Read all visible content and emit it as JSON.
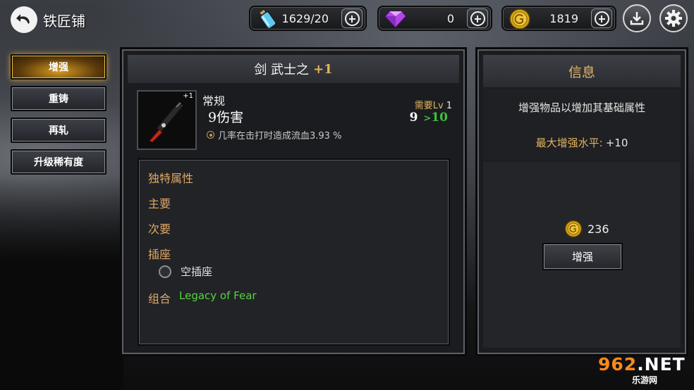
{
  "header": {
    "title": "铁匠铺",
    "back_icon": "back-arrow-icon"
  },
  "resources": {
    "potion": {
      "value": "1629/20",
      "icon": "potion-bottle-icon"
    },
    "gem": {
      "value": "0",
      "icon": "purple-gem-icon"
    },
    "gold": {
      "value": "1819",
      "icon": "gold-coin-icon"
    },
    "download_icon": "download-icon",
    "settings_icon": "gear-icon"
  },
  "menu": {
    "items": [
      {
        "label": "增强",
        "active": true
      },
      {
        "label": "重铸",
        "active": false
      },
      {
        "label": "再轧",
        "active": false
      },
      {
        "label": "升级稀有度",
        "active": false
      }
    ]
  },
  "item": {
    "name": "剑 武士之",
    "plus": "+1",
    "badge": "+1",
    "rarity": "常规",
    "damage": "9伤害",
    "effect": "几率在击打时造成流血3.93 %",
    "req_label": "需要Lv",
    "req_value": "1",
    "level_from": "9",
    "level_arrow": ">",
    "level_to": "10"
  },
  "properties": {
    "unique": "独特属性",
    "primary": "主要",
    "secondary": "次要",
    "socket": "插座",
    "empty_socket": "空插座",
    "combo_label": "组合",
    "combo_value": "Legacy of Fear"
  },
  "info": {
    "title": "信息",
    "description": "增强物品以增加其基础属性",
    "max_label": "最大增强水平:",
    "max_value": "+10",
    "cost": "236",
    "button": "增强"
  },
  "watermark": {
    "big_a": "962",
    "big_b": ".NET",
    "small": "乐游网"
  },
  "colors": {
    "accent_gold": "#e2b35f",
    "combo_green": "#55d43e",
    "active_menu": "#d69a22"
  }
}
